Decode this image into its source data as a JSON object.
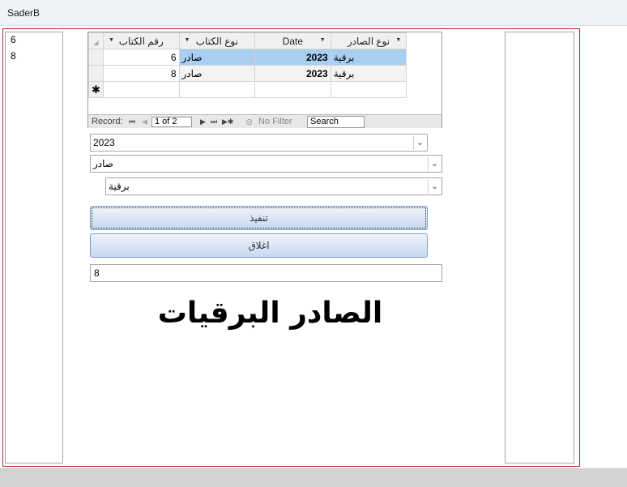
{
  "window": {
    "title": "SaderB"
  },
  "left_list": [
    "6",
    "8"
  ],
  "datasheet": {
    "columns": [
      "رقم الكتاب",
      "نوع الكتاب",
      "Date",
      "نوع الصادر"
    ],
    "rows": [
      {
        "num": "6",
        "type": "صادر",
        "date": "2023",
        "kind": "برقية"
      },
      {
        "num": "8",
        "type": "صادر",
        "date": "2023",
        "kind": "برقية"
      }
    ],
    "new_row_marker": "✱",
    "nav": {
      "record_label": "Record:",
      "record_value": "1 of 2",
      "no_filter": "No Filter",
      "search": "Search"
    }
  },
  "combos": {
    "year": "2023",
    "type": "صادر",
    "kind": "برقية"
  },
  "buttons": {
    "execute": "تنفيذ",
    "close": "اغلاق"
  },
  "result_box": "8",
  "heading": "الصادر البرقيات"
}
